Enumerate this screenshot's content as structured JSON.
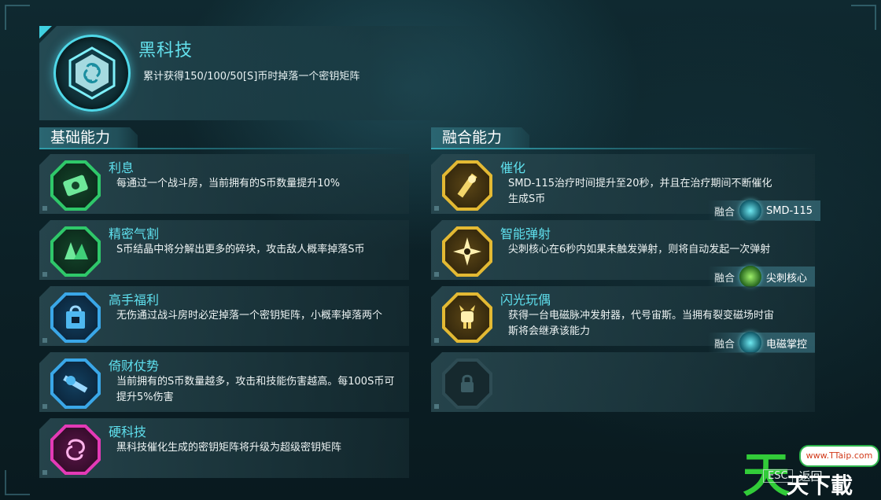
{
  "header": {
    "title": "黑科技",
    "description": "累计获得150/100/50[S]币时掉落一个密钥矩阵",
    "icon": "data-hex-icon"
  },
  "sections": {
    "basic_title": "基础能力",
    "fusion_title": "融合能力"
  },
  "basic_abilities": [
    {
      "name": "利息",
      "desc": "每通过一个战斗房，当前拥有的S币数量提升10%",
      "icon": "money-cash-icon",
      "color": "#2fc86a"
    },
    {
      "name": "精密气割",
      "desc": "S币结晶中将分解出更多的碎块，攻击敌人概率掉落S币",
      "icon": "crystal-shard-icon",
      "color": "#2fc86a"
    },
    {
      "name": "高手福利",
      "desc": "无伤通过战斗房时必定掉落一个密钥矩阵，小概率掉落两个",
      "icon": "gift-bag-icon",
      "color": "#3aa7e8"
    },
    {
      "name": "倚财仗势",
      "desc": "当前拥有的S币数量越多，攻击和技能伤害越高。每100S币可提升5%伤害",
      "icon": "sword-coin-icon",
      "color": "#3aa7e8"
    },
    {
      "name": "硬科技",
      "desc": "黑科技催化生成的密钥矩阵将升级为超级密钥矩阵",
      "icon": "swirl-icon",
      "color": "#e43ab6"
    }
  ],
  "fusion_abilities": [
    {
      "name": "催化",
      "desc": "SMD-115治疗时间提升至20秒，并且在治疗期间不断催化生成S币",
      "icon": "catalyst-icon",
      "color": "#e3b933",
      "fusion_label": "融合",
      "fusion_with": "SMD-115",
      "fusion_icon": "drone-icon"
    },
    {
      "name": "智能弹射",
      "desc": "尖刺核心在6秒内如果未触发弹射，则将自动发起一次弹射",
      "icon": "shuriken-icon",
      "color": "#e3b933",
      "fusion_label": "融合",
      "fusion_with": "尖刺核心",
      "fusion_icon": "spike-core-icon"
    },
    {
      "name": "闪光玩偶",
      "desc": "获得一台电磁脉冲发射器，代号宙斯。当拥有裂变磁场时宙斯将会继承该能力",
      "icon": "robot-doll-icon",
      "color": "#e3b933",
      "fusion_label": "融合",
      "fusion_with": "电磁掌控",
      "fusion_icon": "electromagnet-icon"
    },
    {
      "name": "",
      "desc": "",
      "icon": "lock-icon",
      "color": "#2e4c54"
    }
  ],
  "footer": {
    "esc_key": "ESC",
    "back_label": "返回"
  },
  "watermark": {
    "big_char": "天",
    "small_text": "天下載",
    "url": "www.TTaip.com"
  }
}
